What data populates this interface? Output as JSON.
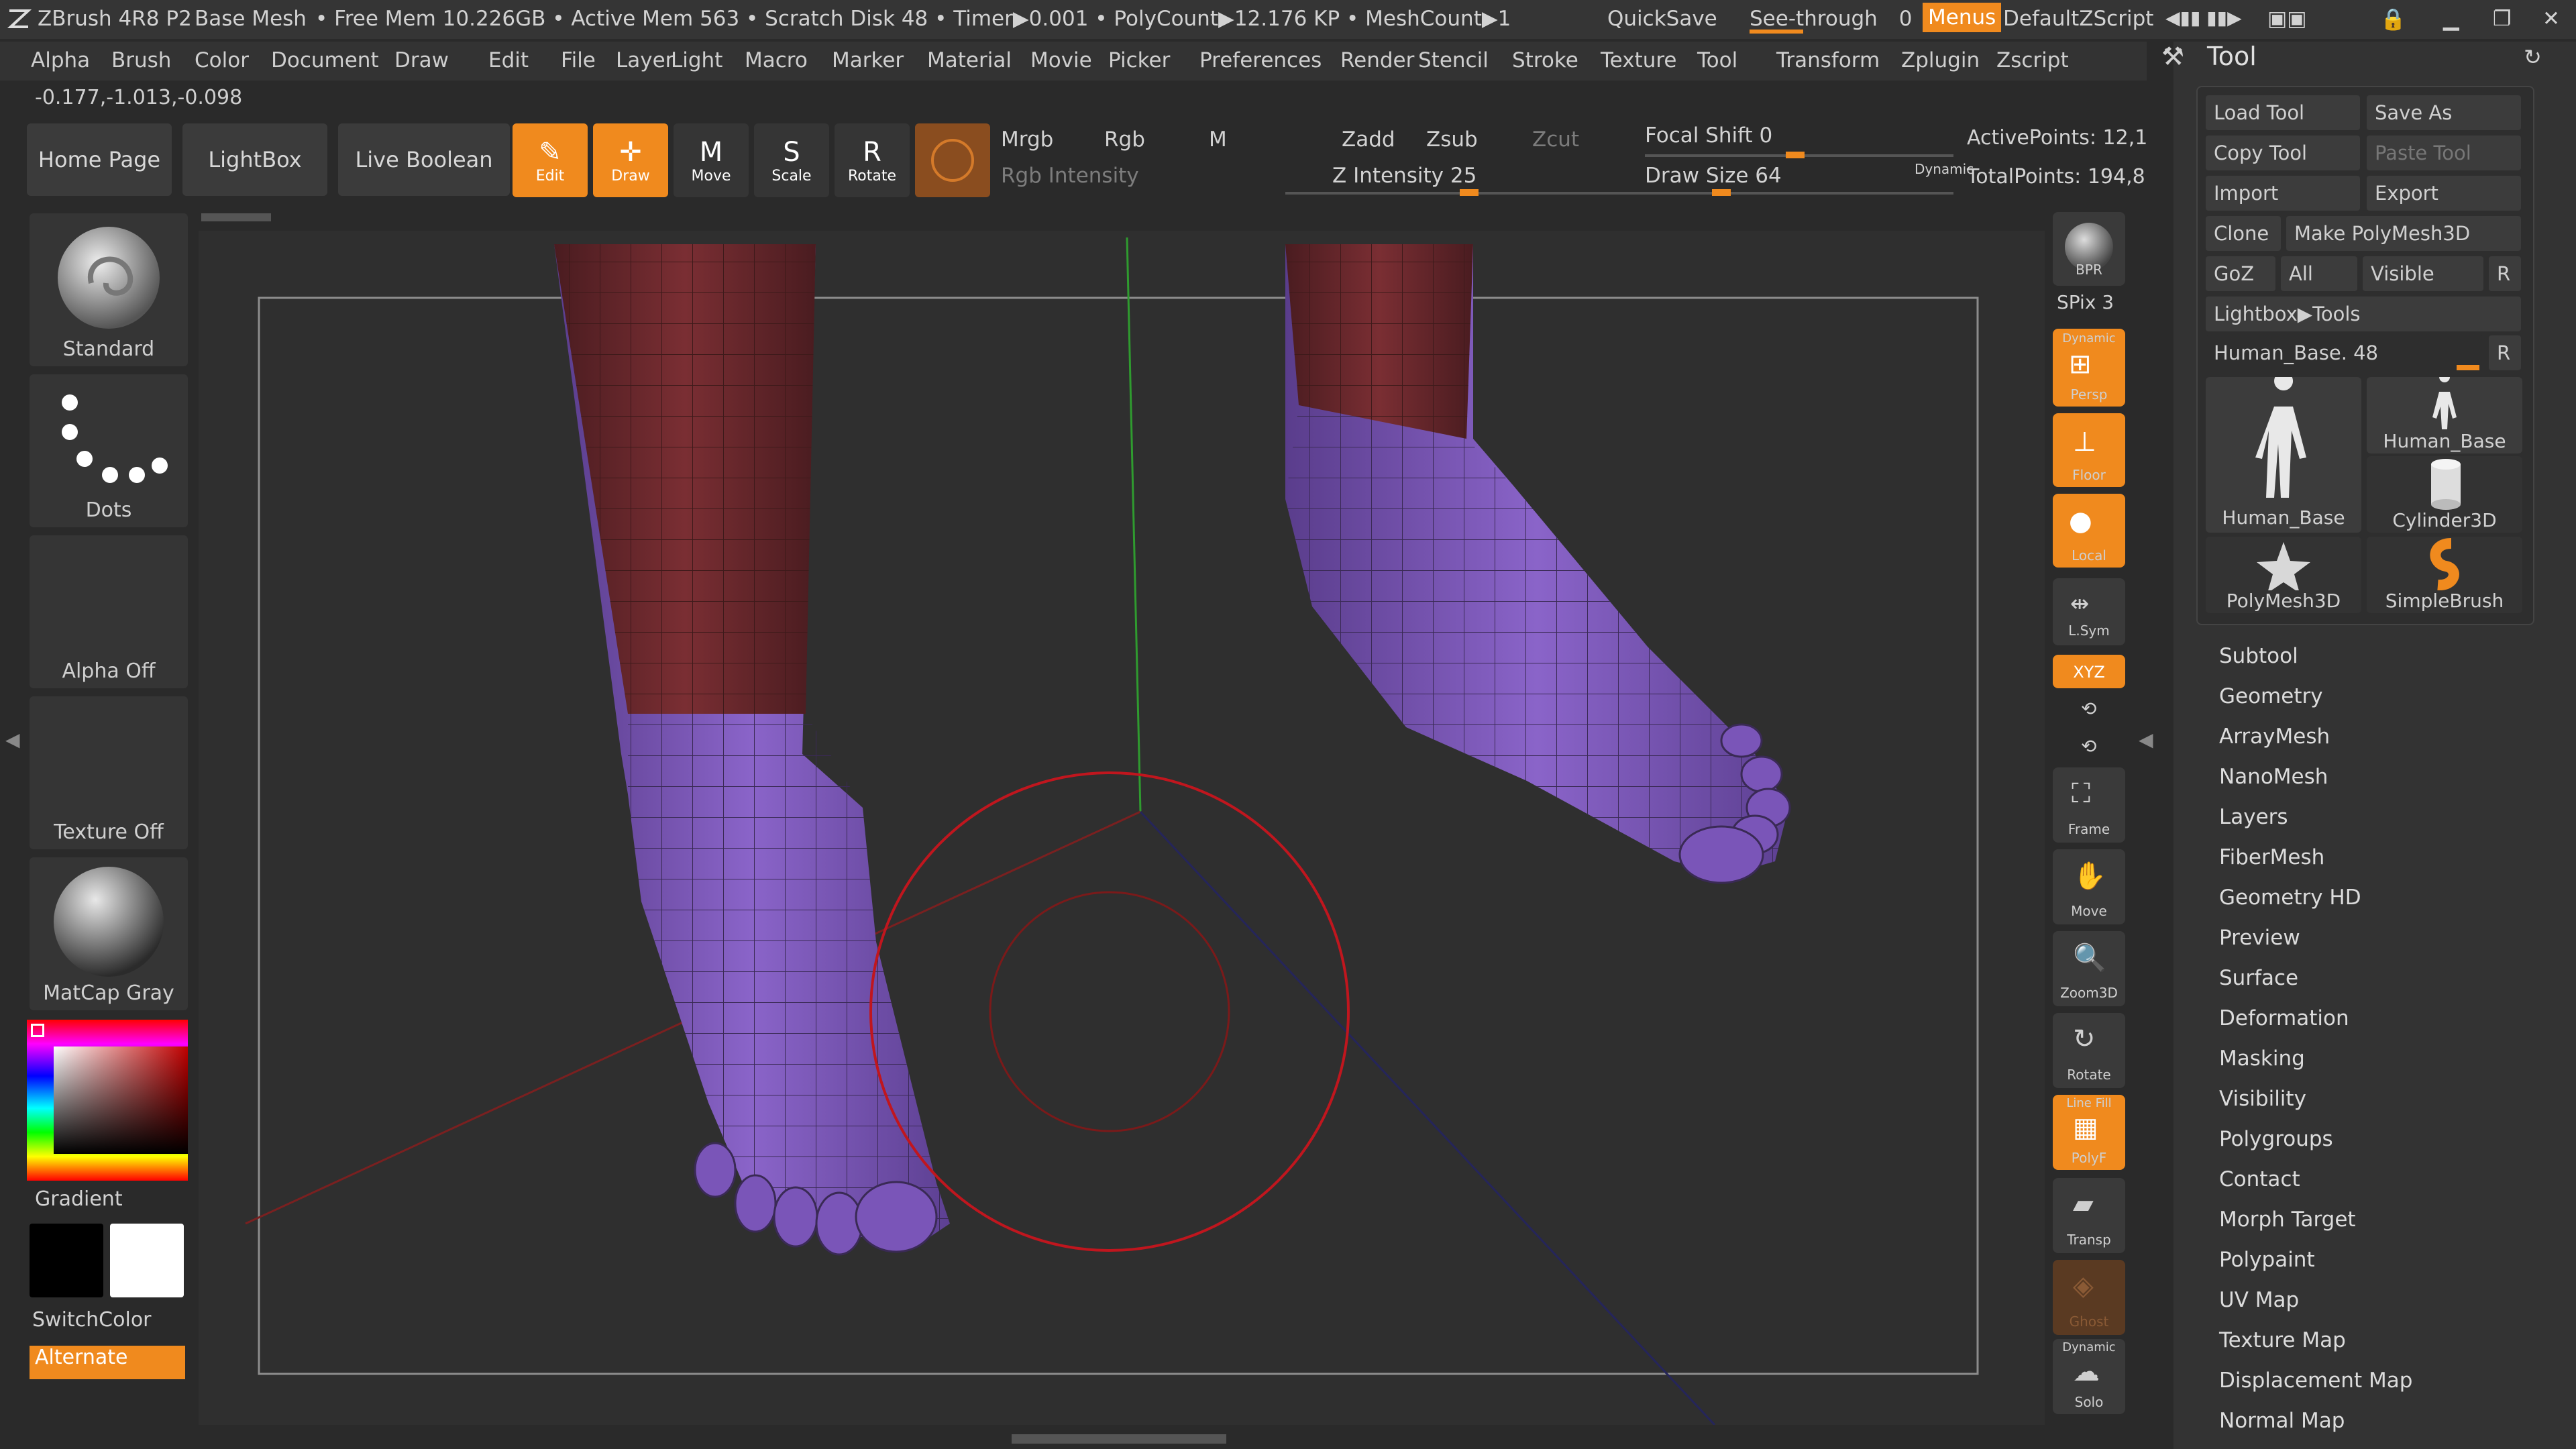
{
  "titlebar": {
    "app": "ZBrush 4R8 P2",
    "doc": "Base Mesh",
    "stats": "• Free Mem 10.226GB • Active Mem 563 • Scratch Disk 48 • Timer▶0.001 • PolyCount▶12.176 KP • MeshCount▶1",
    "quicksave": "QuickSave",
    "see_through": "See-through",
    "see_through_value": "0",
    "menus": "Menus",
    "zscript": "DefaultZScript"
  },
  "menu": [
    "Alpha",
    "Brush",
    "Color",
    "Document",
    "Draw",
    "Edit",
    "File",
    "Layer",
    "Light",
    "Macro",
    "Marker",
    "Material",
    "Movie",
    "Picker",
    "Preferences",
    "Render",
    "Stencil",
    "Stroke",
    "Texture",
    "Tool",
    "Transform",
    "Zplugin",
    "Zscript"
  ],
  "coords": "-0.177,-1.013,-0.098",
  "palette": {
    "home": "Home Page",
    "lightbox": "LightBox",
    "live_boolean": "Live Boolean"
  },
  "transform_buttons": [
    {
      "label": "Edit",
      "active": true
    },
    {
      "label": "Draw",
      "active": true
    },
    {
      "label": "Move",
      "active": false
    },
    {
      "label": "Scale",
      "active": false
    },
    {
      "label": "Rotate",
      "active": false
    }
  ],
  "color_controls": {
    "mrgb": "Mrgb",
    "rgb": "Rgb",
    "m": "M",
    "rgb_intensity": "Rgb Intensity",
    "zadd": "Zadd",
    "zsub": "Zsub",
    "zcut": "Zcut",
    "z_intensity": "Z Intensity 25",
    "focal_shift": "Focal Shift 0",
    "draw_size": "Draw Size 64",
    "dynamic": "Dynamic",
    "active_points": "ActivePoints: 12,1",
    "total_points": "TotalPoints: 194,8"
  },
  "shelf": {
    "brush": "Standard",
    "stroke": "Dots",
    "alpha": "Alpha Off",
    "texture": "Texture Off",
    "material": "MatCap Gray",
    "gradient": "Gradient",
    "switchcolor": "SwitchColor",
    "alternate": "Alternate"
  },
  "right_strip": {
    "bpr": "BPR",
    "spix": "SPix 3",
    "dynamic": "Dynamic",
    "persp": "Persp",
    "floor": "Floor",
    "local": "Local",
    "lsym": "L.Sym",
    "xyz": "XYZ",
    "frame": "Frame",
    "move": "Move",
    "zoom3d": "Zoom3D",
    "rotate": "Rotate",
    "linefill": "Line Fill",
    "polyf": "PolyF",
    "transp": "Transp",
    "ghost": "Ghost",
    "dynamic2": "Dynamic",
    "solo": "Solo"
  },
  "tool": {
    "title": "Tool",
    "load": "Load Tool",
    "save_as": "Save As",
    "copy": "Copy Tool",
    "paste": "Paste Tool",
    "import": "Import",
    "export": "Export",
    "clone": "Clone",
    "make_polymesh": "Make PolyMesh3D",
    "goz": "GoZ",
    "all": "All",
    "visible": "Visible",
    "r": "R",
    "lightbox_tools": "Lightbox▶Tools",
    "current": "Human_Base. 48",
    "thumbs": [
      "Human_Base",
      "Human_Base",
      "Cylinder3D",
      "PolyMesh3D",
      "SimpleBrush"
    ],
    "sections": [
      "Subtool",
      "Geometry",
      "ArrayMesh",
      "NanoMesh",
      "Layers",
      "FiberMesh",
      "Geometry HD",
      "Preview",
      "Surface",
      "Deformation",
      "Masking",
      "Visibility",
      "Polygroups",
      "Contact",
      "Morph Target",
      "Polypaint",
      "UV Map",
      "Texture Map",
      "Displacement Map",
      "Normal Map"
    ]
  },
  "colors": {
    "accent": "#f08a1e",
    "mesh": "#7a52b8",
    "mesh_upper": "#6e2a2e"
  }
}
